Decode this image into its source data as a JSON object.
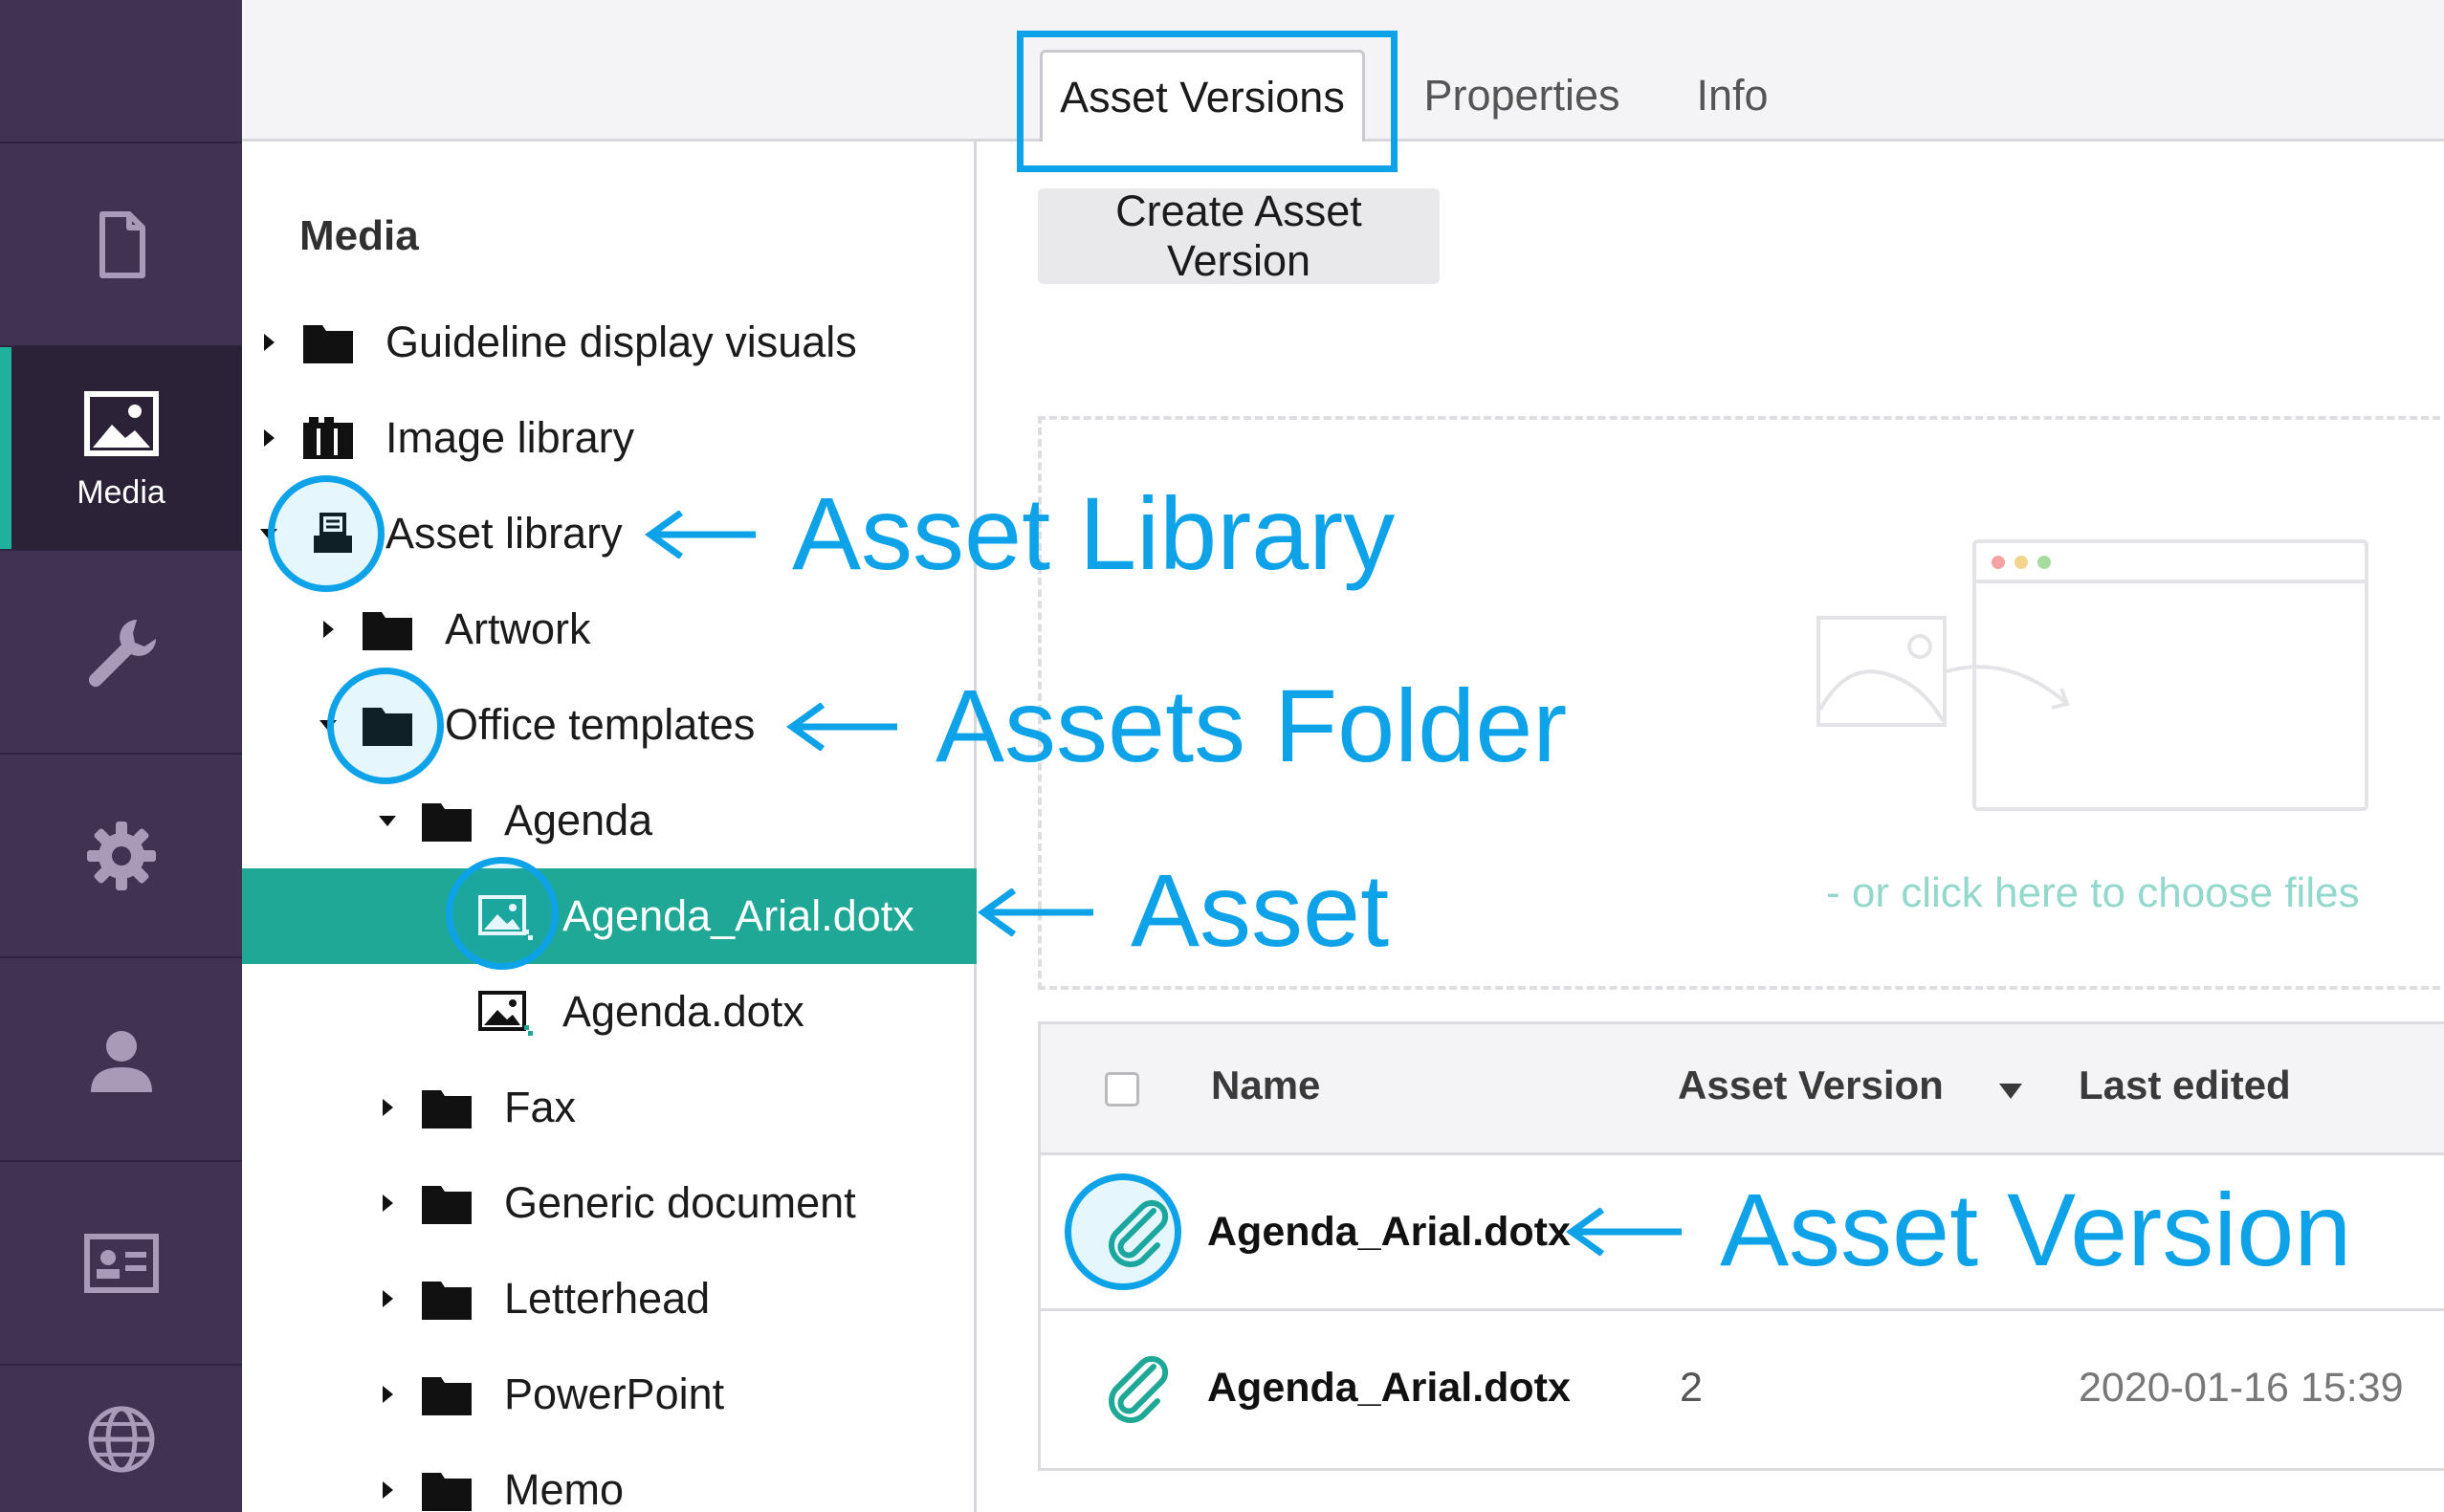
{
  "rail": {
    "items": [
      {
        "name": "content",
        "icon": "document-icon",
        "label": ""
      },
      {
        "name": "media",
        "icon": "image-icon",
        "label": "Media",
        "active": true
      },
      {
        "name": "settings",
        "icon": "wrench-icon",
        "label": ""
      },
      {
        "name": "packages",
        "icon": "gear-icon",
        "label": ""
      },
      {
        "name": "users",
        "icon": "user-icon",
        "label": ""
      },
      {
        "name": "members",
        "icon": "id-card-icon",
        "label": ""
      },
      {
        "name": "translation",
        "icon": "globe-icon",
        "label": ""
      }
    ]
  },
  "tree": {
    "title": "Media",
    "nodes": [
      {
        "label": "Guideline display visuals",
        "icon": "folder-icon",
        "expanded": false
      },
      {
        "label": "Image library",
        "icon": "image-library-icon",
        "expanded": false
      },
      {
        "label": "Asset library",
        "icon": "asset-library-icon",
        "expanded": true
      },
      {
        "label": "Artwork",
        "icon": "folder-icon",
        "expanded": false
      },
      {
        "label": "Office templates",
        "icon": "folder-icon",
        "expanded": true
      },
      {
        "label": "Agenda",
        "icon": "folder-icon",
        "expanded": true
      },
      {
        "label": "Agenda_Arial.dotx",
        "icon": "asset-file-icon",
        "selected": true
      },
      {
        "label": "Agenda.dotx",
        "icon": "asset-file-icon"
      },
      {
        "label": "Fax",
        "icon": "folder-icon",
        "expanded": false
      },
      {
        "label": "Generic document",
        "icon": "folder-icon",
        "expanded": false
      },
      {
        "label": "Letterhead",
        "icon": "folder-icon",
        "expanded": false
      },
      {
        "label": "PowerPoint",
        "icon": "folder-icon",
        "expanded": false
      },
      {
        "label": "Memo",
        "icon": "folder-icon",
        "expanded": false
      }
    ]
  },
  "tabs": [
    "Asset Versions",
    "Properties",
    "Info"
  ],
  "active_tab": "Asset Versions",
  "create_button": "Create Asset Version",
  "dropzone": {
    "text": "- or click here to choose files"
  },
  "table": {
    "columns": [
      "Name",
      "Asset Version",
      "Last edited"
    ],
    "rows": [
      {
        "name": "Agenda_Arial.dotx",
        "version": "",
        "edited": ""
      },
      {
        "name": "Agenda_Arial.dotx",
        "version": "2",
        "edited": "2020-01-16 15:39"
      }
    ]
  },
  "annotations": {
    "asset_library": "Asset Library",
    "assets_folder": "Assets Folder",
    "asset": "Asset",
    "asset_version": "Asset Version"
  },
  "colors": {
    "rail_bg": "#3f3351",
    "accent_teal": "#1fa896",
    "annotation_blue": "#0ea3e8"
  }
}
